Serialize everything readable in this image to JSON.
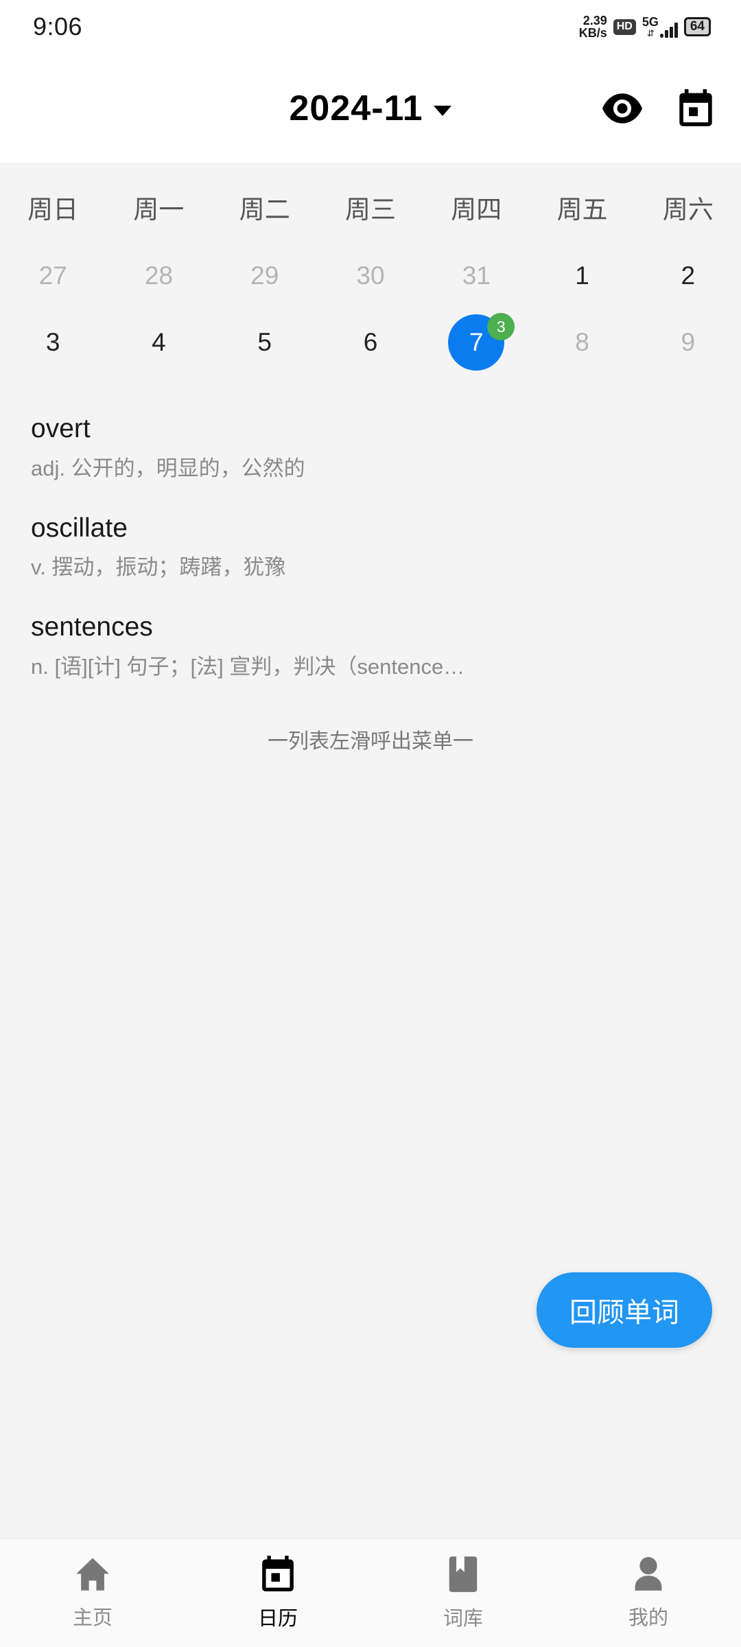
{
  "statusbar": {
    "time": "9:06",
    "net_speed_value": "2.39",
    "net_speed_unit": "KB/s",
    "hd_badge": "HD",
    "network_type": "5G",
    "battery_level": "64"
  },
  "header": {
    "title": "2024-11",
    "dropdown_icon": "chevron-down-icon",
    "eye_icon": "eye-icon",
    "calendar_icon": "calendar-icon"
  },
  "calendar": {
    "weekdays": [
      "周日",
      "周一",
      "周二",
      "周三",
      "周四",
      "周五",
      "周六"
    ],
    "selected_color": "#0a7cf0",
    "badge_color": "#4caf50",
    "rows": [
      [
        {
          "day": "27",
          "state": "outside"
        },
        {
          "day": "28",
          "state": "outside"
        },
        {
          "day": "29",
          "state": "outside"
        },
        {
          "day": "30",
          "state": "outside"
        },
        {
          "day": "31",
          "state": "outside"
        },
        {
          "day": "1",
          "state": "normal"
        },
        {
          "day": "2",
          "state": "normal"
        }
      ],
      [
        {
          "day": "3",
          "state": "normal"
        },
        {
          "day": "4",
          "state": "normal"
        },
        {
          "day": "5",
          "state": "normal"
        },
        {
          "day": "6",
          "state": "normal"
        },
        {
          "day": "7",
          "state": "selected",
          "badge": "3"
        },
        {
          "day": "8",
          "state": "disabled"
        },
        {
          "day": "9",
          "state": "disabled"
        }
      ]
    ]
  },
  "words": [
    {
      "term": "overt",
      "definition": "adj. 公开的，明显的，公然的"
    },
    {
      "term": "oscillate",
      "definition": "v. 摆动，振动；踌躇，犹豫"
    },
    {
      "term": "sentences",
      "definition": "n. [语][计] 句子；[法] 宣判，判决（sentence…"
    }
  ],
  "list_hint": "一列表左滑呼出菜单一",
  "fab": {
    "label": "回顾单词",
    "color": "#2196f3"
  },
  "bottomnav": {
    "items": [
      {
        "label": "主页",
        "icon": "home-icon",
        "active": false
      },
      {
        "label": "日历",
        "icon": "calendar-icon",
        "active": true
      },
      {
        "label": "词库",
        "icon": "book-icon",
        "active": false
      },
      {
        "label": "我的",
        "icon": "person-icon",
        "active": false
      }
    ]
  }
}
